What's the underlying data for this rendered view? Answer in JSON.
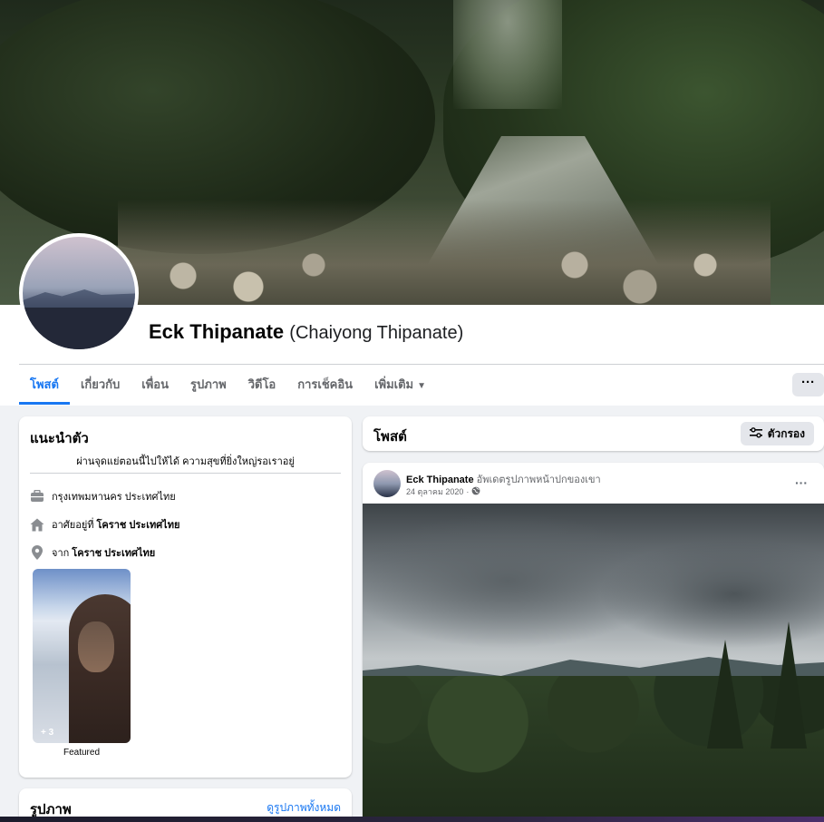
{
  "profile": {
    "name": "Eck Thipanate",
    "alt_name": "(Chaiyong Thipanate)"
  },
  "tabs": [
    {
      "label": "โพสต์",
      "active": true
    },
    {
      "label": "เกี่ยวกับ"
    },
    {
      "label": "เพื่อน"
    },
    {
      "label": "รูปภาพ"
    },
    {
      "label": "วิดีโอ"
    },
    {
      "label": "การเช็คอิน"
    },
    {
      "label": "เพิ่มเติม",
      "has_dropdown": true
    }
  ],
  "more_button": "···",
  "intro": {
    "title": "แนะนำตัว",
    "bio": "ผ่านจุดแย่ตอนนี้ไปให้ได้ ความสุขที่ยิ่งใหญ่รอเราอยู่",
    "work": {
      "text": "กรุงเทพมหานคร ประเทศไทย",
      "icon": "briefcase-icon"
    },
    "lives": {
      "prefix": "อาศัยอยู่ที่",
      "place": "โคราช ประเทศไทย",
      "icon": "home-icon"
    },
    "from": {
      "prefix": "จาก",
      "place": "โคราช ประเทศไทย",
      "icon": "location-pin-icon"
    },
    "featured": {
      "count_badge": "+ 3",
      "label": "Featured"
    }
  },
  "photos_card": {
    "title": "รูปภาพ",
    "see_all": "ดูรูปภาพทั้งหมด"
  },
  "posts_header": {
    "title": "โพสต์",
    "filter_label": "ตัวกรอง"
  },
  "post": {
    "author": "Eck Thipanate",
    "action": "อัพเดตรูปภาพหน้าปกของเขา",
    "date": "24 ตุลาคม 2020",
    "separator": "·",
    "options": "···"
  },
  "colors": {
    "accent": "#1877f2",
    "background": "#f0f2f5",
    "card": "#ffffff",
    "secondary_text": "#65676b",
    "button_gray": "#e4e6eb"
  }
}
